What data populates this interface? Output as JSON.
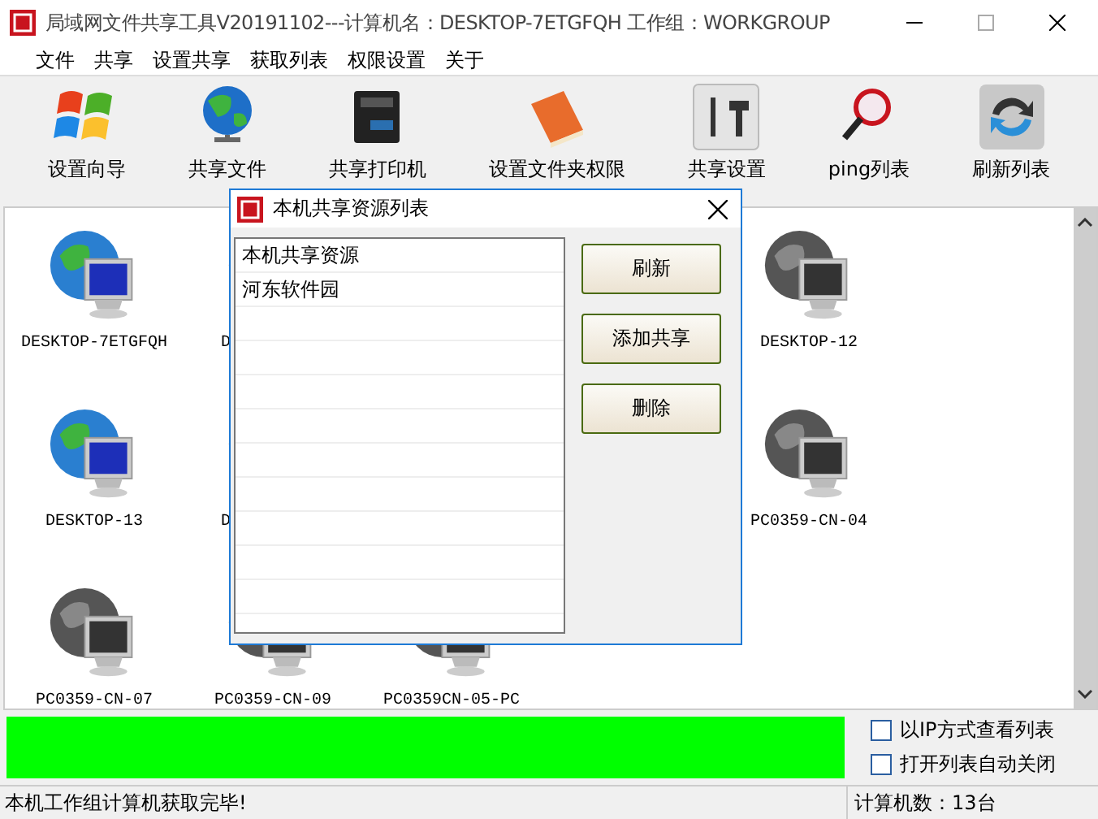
{
  "window": {
    "title": "局域网文件共享工具V20191102---计算机名：DESKTOP-7ETGFQH  工作组：WORKGROUP"
  },
  "menu": [
    "文件",
    "共享",
    "设置共享",
    "获取列表",
    "权限设置",
    "关于"
  ],
  "toolbar": [
    {
      "kind": "wizard",
      "label": "设置向导"
    },
    {
      "kind": "globe",
      "label": "共享文件"
    },
    {
      "kind": "printer",
      "label": "共享打印机"
    },
    {
      "kind": "book",
      "label": "设置文件夹权限"
    },
    {
      "kind": "tools",
      "label": "共享设置"
    },
    {
      "kind": "search",
      "label": "ping列表"
    },
    {
      "kind": "refresh",
      "label": "刷新列表"
    }
  ],
  "computers": [
    {
      "left": [
        {
          "kind": "computer",
          "name": "DESKTOP-7ETGFQH",
          "online": true
        },
        {
          "kind": "partial",
          "name": "D"
        }
      ],
      "right": [
        {
          "kind": "computer",
          "name": "DESKTOP-12",
          "online": false
        }
      ]
    },
    {
      "left": [
        {
          "kind": "computer",
          "name": "DESKTOP-13",
          "online": true
        },
        {
          "kind": "partial",
          "name": "D"
        }
      ],
      "right": [
        {
          "kind": "computer",
          "name": "PC0359-CN-04",
          "online": false
        }
      ]
    },
    {
      "left": [
        {
          "kind": "computer",
          "name": "PC0359-CN-07",
          "online": false
        },
        {
          "kind": "computer",
          "name": "PC0359-CN-09",
          "online": false
        },
        {
          "kind": "computer",
          "name": "PC0359CN-05-PC",
          "online": false
        }
      ]
    }
  ],
  "dialog": {
    "title": "本机共享资源列表",
    "list_header": "本机共享资源",
    "items": [
      "河东软件园"
    ],
    "buttons": [
      "刷新",
      "添加共享",
      "删除"
    ]
  },
  "progress": {
    "level": 1
  },
  "options": [
    {
      "label": "以IP方式查看列表",
      "checked": false
    },
    {
      "label": "打开列表自动关闭",
      "checked": false
    }
  ],
  "status_bar": {
    "message": "本机工作组计算机获取完毕!",
    "count": "计算机数：13台"
  }
}
